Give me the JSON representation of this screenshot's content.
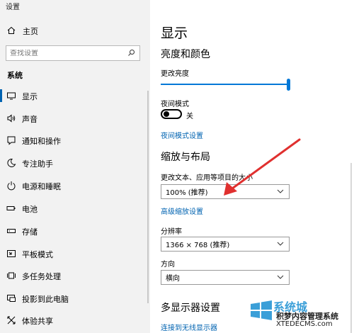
{
  "app": {
    "title": "设置"
  },
  "sidebar": {
    "home_label": "主页",
    "search_placeholder": "查找设置",
    "section": "系统",
    "items": [
      {
        "label": "显示",
        "icon": "monitor-icon",
        "active": true
      },
      {
        "label": "声音",
        "icon": "speaker-icon"
      },
      {
        "label": "通知和操作",
        "icon": "notification-icon"
      },
      {
        "label": "专注助手",
        "icon": "moon-icon"
      },
      {
        "label": "电源和睡眠",
        "icon": "power-icon"
      },
      {
        "label": "电池",
        "icon": "battery-icon"
      },
      {
        "label": "存储",
        "icon": "storage-icon"
      },
      {
        "label": "平板模式",
        "icon": "tablet-icon"
      },
      {
        "label": "多任务处理",
        "icon": "multitask-icon"
      },
      {
        "label": "投影到此电脑",
        "icon": "project-icon"
      },
      {
        "label": "体验共享",
        "icon": "share-icon"
      }
    ]
  },
  "main": {
    "title": "显示",
    "brightness_section": "亮度和颜色",
    "brightness_label": "更改亮度",
    "brightness_value": 1.0,
    "night_mode_label": "夜间模式",
    "night_mode_state": "关",
    "night_mode_link": "夜间模式设置",
    "scale_section": "缩放与布局",
    "scale_label": "更改文本、应用等项目的大小",
    "scale_value": "100% (推荐)",
    "advanced_scale_link": "高级缩放设置",
    "resolution_label": "分辨率",
    "resolution_value": "1366 × 768 (推荐)",
    "orientation_label": "方向",
    "orientation_value": "横向",
    "multi_display_section": "多显示器设置",
    "wireless_link": "连接到无线显示器"
  },
  "watermark": {
    "brand": "系统城",
    "line1": "积梦内容管理系统",
    "line2": "XTEDECMS.com"
  },
  "colors": {
    "accent": "#0078d7",
    "link": "#0063b1",
    "arrow": "#e0302f",
    "sidebar_bg": "#f2f2f2"
  }
}
